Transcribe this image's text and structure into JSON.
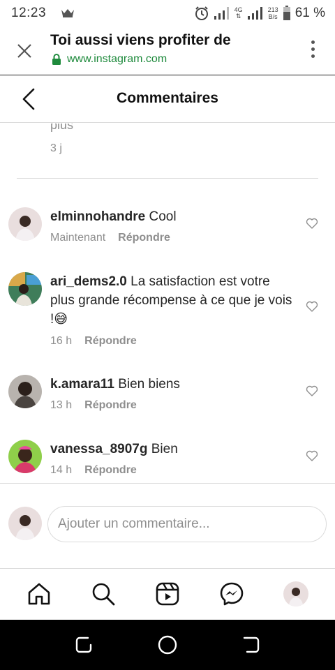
{
  "status_bar": {
    "time": "12:23",
    "network": "4G",
    "speed_value": "213",
    "speed_unit": "B/s",
    "battery": "61 %"
  },
  "browser": {
    "title": "Toi aussi viens profiter de",
    "url": "www.instagram.com"
  },
  "header": {
    "title": "Commentaires"
  },
  "previous_comment": {
    "text_tail": "plus",
    "time": "3 j"
  },
  "comments": [
    {
      "username": "elminnohandre",
      "text": "Cool",
      "time": "Maintenant",
      "reply_label": "Répondre"
    },
    {
      "username": "ari_dems2.0",
      "text": "La satisfaction est votre plus grande récompense à ce que je vois !😅",
      "time": "16 h",
      "reply_label": "Répondre"
    },
    {
      "username": "k.amara11",
      "text": "Bien biens",
      "time": "13 h",
      "reply_label": "Répondre"
    },
    {
      "username": "vanessa_8907g",
      "text": "Bien",
      "time": "14 h",
      "reply_label": "Répondre"
    }
  ],
  "add_comment": {
    "placeholder": "Ajouter un commentaire..."
  },
  "bottom_nav": [
    "home-icon",
    "search-icon",
    "reels-icon",
    "messenger-icon",
    "profile-avatar"
  ],
  "colors": {
    "accent_green": "#1e8a3c",
    "muted_text": "#8e8e8e",
    "divider": "#dbdbdb"
  }
}
